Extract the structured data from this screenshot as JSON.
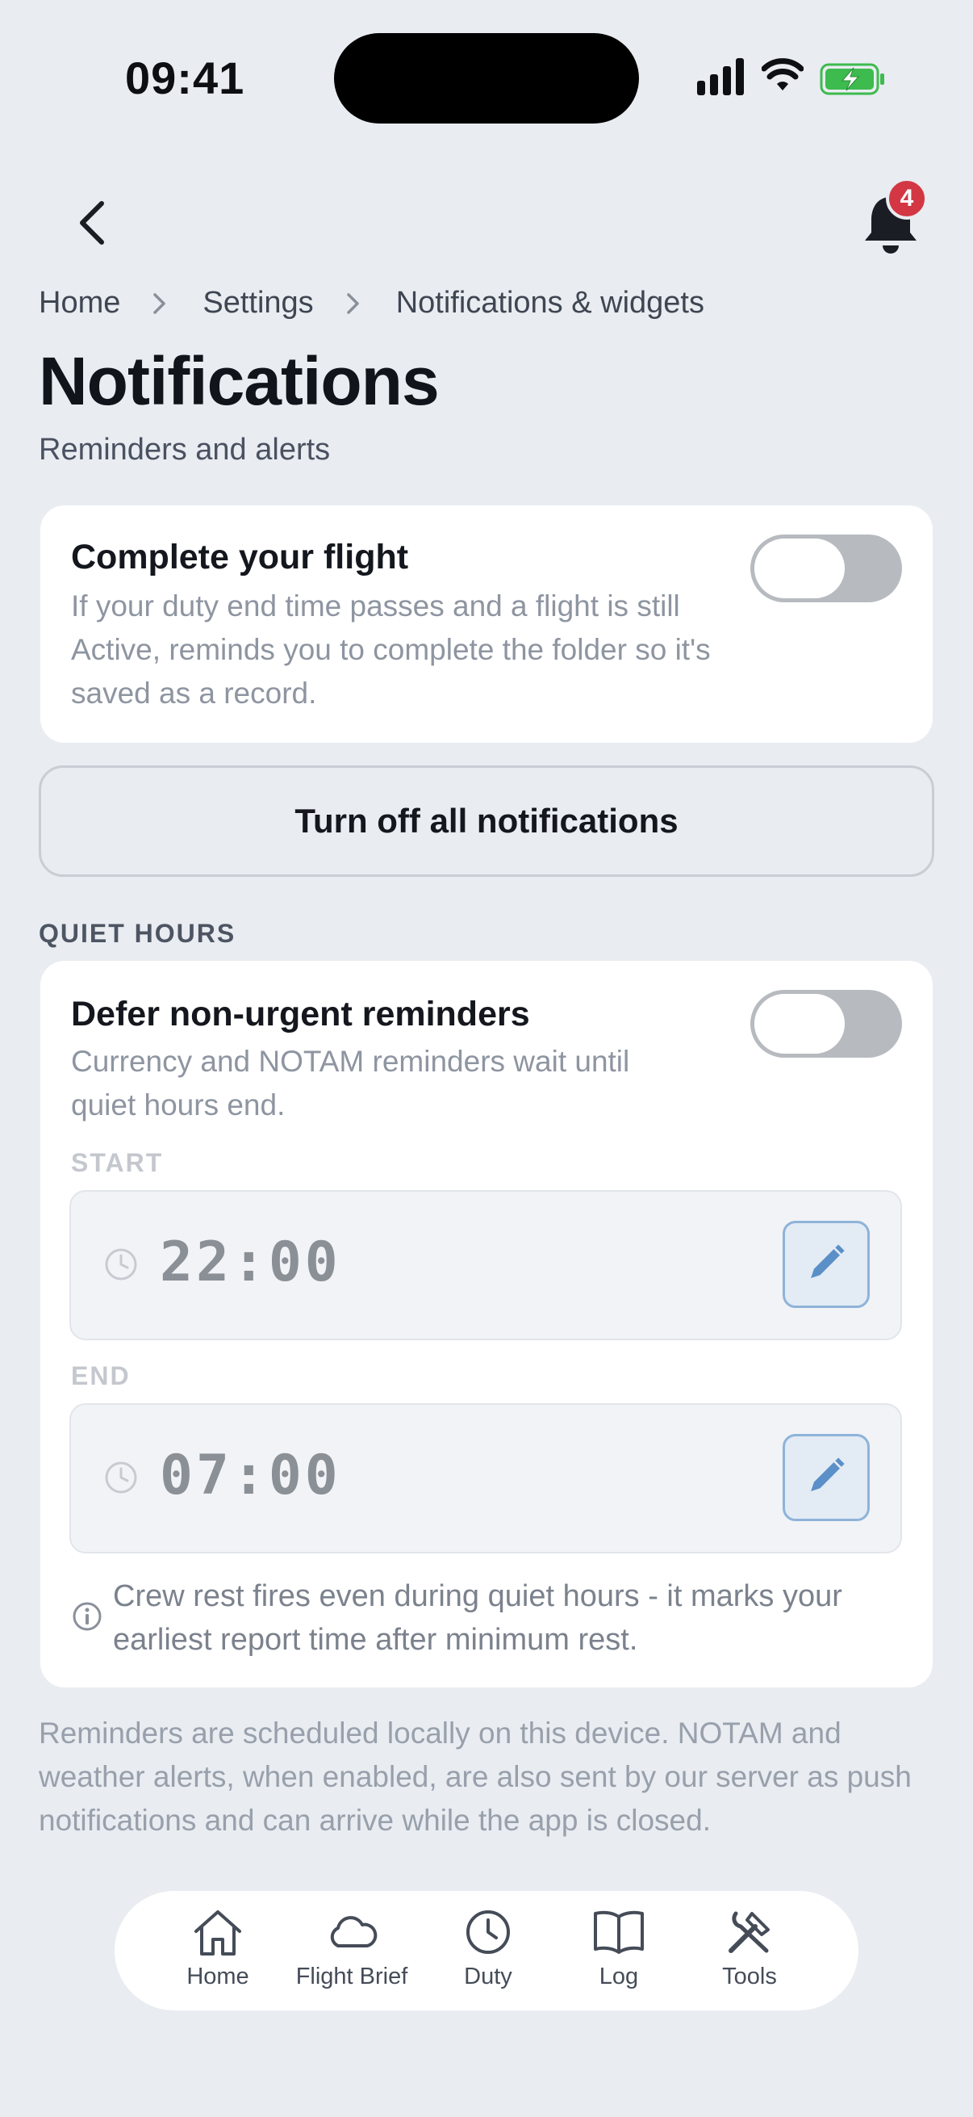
{
  "status_bar": {
    "time": "09:41"
  },
  "header": {
    "notification_count": "4"
  },
  "breadcrumb": [
    "Home",
    "Settings",
    "Notifications & widgets"
  ],
  "page": {
    "title": "Notifications",
    "subtitle": "Reminders and alerts"
  },
  "complete_flight": {
    "title": "Complete your flight",
    "description": "If your duty end time passes and a flight is still Active, reminds you to complete the folder so it's saved as a record.",
    "enabled": false
  },
  "turn_off_all_label": "Turn off all notifications",
  "quiet_hours": {
    "section_label": "QUIET HOURS",
    "title": "Defer non-urgent reminders",
    "description": "Currency and NOTAM reminders wait until quiet hours end.",
    "enabled": false,
    "start_label": "START",
    "start_time": "22:00",
    "end_label": "END",
    "end_time": "07:00",
    "info": "Crew rest fires even during quiet hours - it marks your earliest report time after minimum rest."
  },
  "footer_note": "Reminders are scheduled locally on this device. NOTAM and weather alerts, when enabled, are also sent by our server as push notifications and can arrive while the app is closed.",
  "tabs": [
    {
      "label": "Home",
      "icon": "home-icon"
    },
    {
      "label": "Flight Brief",
      "icon": "cloud-icon"
    },
    {
      "label": "Duty",
      "icon": "clock-icon"
    },
    {
      "label": "Log",
      "icon": "book-icon"
    },
    {
      "label": "Tools",
      "icon": "tools-icon"
    }
  ],
  "colors": {
    "background": "#e9ecf1",
    "badge": "#d23743",
    "toggle_off": "#b7bbc0",
    "edit_accent": "#5b8fc7"
  }
}
